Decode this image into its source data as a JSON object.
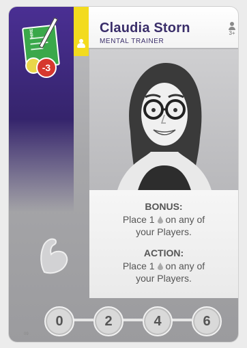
{
  "card": {
    "name": "Claudia Storn",
    "role": "MENTAL TRAINER",
    "player_count": "3+",
    "hire_label": "HIRE",
    "cost": "-3",
    "bonus_title": "BONUS:",
    "bonus_line1": "Place 1",
    "bonus_line1_after": "on any of",
    "bonus_line2": "your Players.",
    "action_title": "ACTION:",
    "action_line1": "Place 1",
    "action_line1_after": "on any of",
    "action_line2": "your Players.",
    "levels": [
      "0",
      "2",
      "4",
      "6"
    ],
    "card_id": "09"
  },
  "colors": {
    "band": "#35246c",
    "stripe": "#f3db1e",
    "cost_badge": "#d6382e",
    "hire_doc": "#3aa84a"
  },
  "icons": [
    "hire-document-icon",
    "coin-icon",
    "person-icon",
    "player-count-icon",
    "drop-icon",
    "muscle-icon",
    "laurel-icon"
  ]
}
